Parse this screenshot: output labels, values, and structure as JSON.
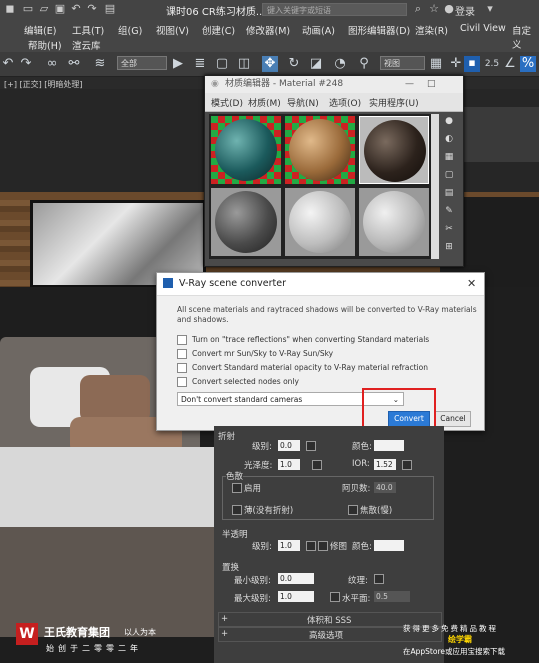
{
  "title_bar": {
    "document_title": "课时06 CR练习材质...",
    "search_placeholder": "键入关键字或短语",
    "login_label": "登录"
  },
  "menu_bar": {
    "row1": [
      "编辑(E)",
      "工具(T)",
      "组(G)",
      "视图(V)",
      "创建(C)",
      "修改器(M)",
      "动画(A)",
      "图形编辑器(D)",
      "渲染(R)",
      "Civil View",
      "自定义"
    ],
    "row2": [
      "帮助(H)",
      "渲云库"
    ]
  },
  "toolbar": {
    "selection_filter": "全部",
    "reference_coord": "视图",
    "snap_value": "2.5"
  },
  "viewport": {
    "label": "[+] [正交] [明暗处理]"
  },
  "material_editor": {
    "title": "材质编辑器 - Material #248",
    "menu": [
      "模式(D)",
      "材质(M)",
      "导航(N)",
      "选项(O)",
      "实用程序(U)"
    ]
  },
  "vray_dialog": {
    "title": "V-Ray scene converter",
    "description": "All scene materials and raytraced shadows will be converted to V-Ray materials and shadows.",
    "options": [
      "Turn on \"trace reflections\" when converting Standard materials",
      "Convert mr Sun/Sky to V-Ray Sun/Sky",
      "Convert Standard material opacity to V-Ray material refraction",
      "Convert selected nodes only"
    ],
    "camera_option": "Don't convert standard cameras",
    "convert_label": "Convert",
    "cancel_label": "Cancel",
    "close_glyph": "✕"
  },
  "parameters": {
    "refraction_header": "折射",
    "level_label": "级别:",
    "level_value": "0.0",
    "color_label": "颜色:",
    "gloss_label": "光泽度:",
    "gloss_value": "1.0",
    "ior_label": "IOR:",
    "ior_value": "1.52",
    "dispersion_header": "色散",
    "enable_label": "启用",
    "abbe_label": "阿贝数:",
    "abbe_value": "40.0",
    "thin_label": "薄(没有折射)",
    "caustics_label": "焦散(慢)",
    "translucency_header": "半透明",
    "trans_level_label": "级别:",
    "trans_level_value": "1.0",
    "thin2_label": "修图",
    "trans_color_label": "颜色:",
    "displacement_header": "置换",
    "min_level_label": "最小级别:",
    "min_level_value": "0.0",
    "texture_label": "纹理:",
    "max_level_label": "最大级别:",
    "max_level_value": "1.0",
    "water_label": "水平面:",
    "water_value": "0.5",
    "volume_rollout": "体积和 SSS",
    "advanced_rollout": "高级选项"
  },
  "watermark": {
    "logo_glyph": "W",
    "brand": "王氏教育集团",
    "slogan": "以人为本",
    "sub": "始创于二零零二年",
    "right_line1": "获得更多免费精品教程",
    "right_line2": "绘学霸",
    "right_line3": "在AppStore或应用宝搜索下载"
  },
  "colors": {
    "highlight_box": "#e02020",
    "convert_button": "#2b7ad6",
    "watermark_red": "#c51f1f"
  }
}
